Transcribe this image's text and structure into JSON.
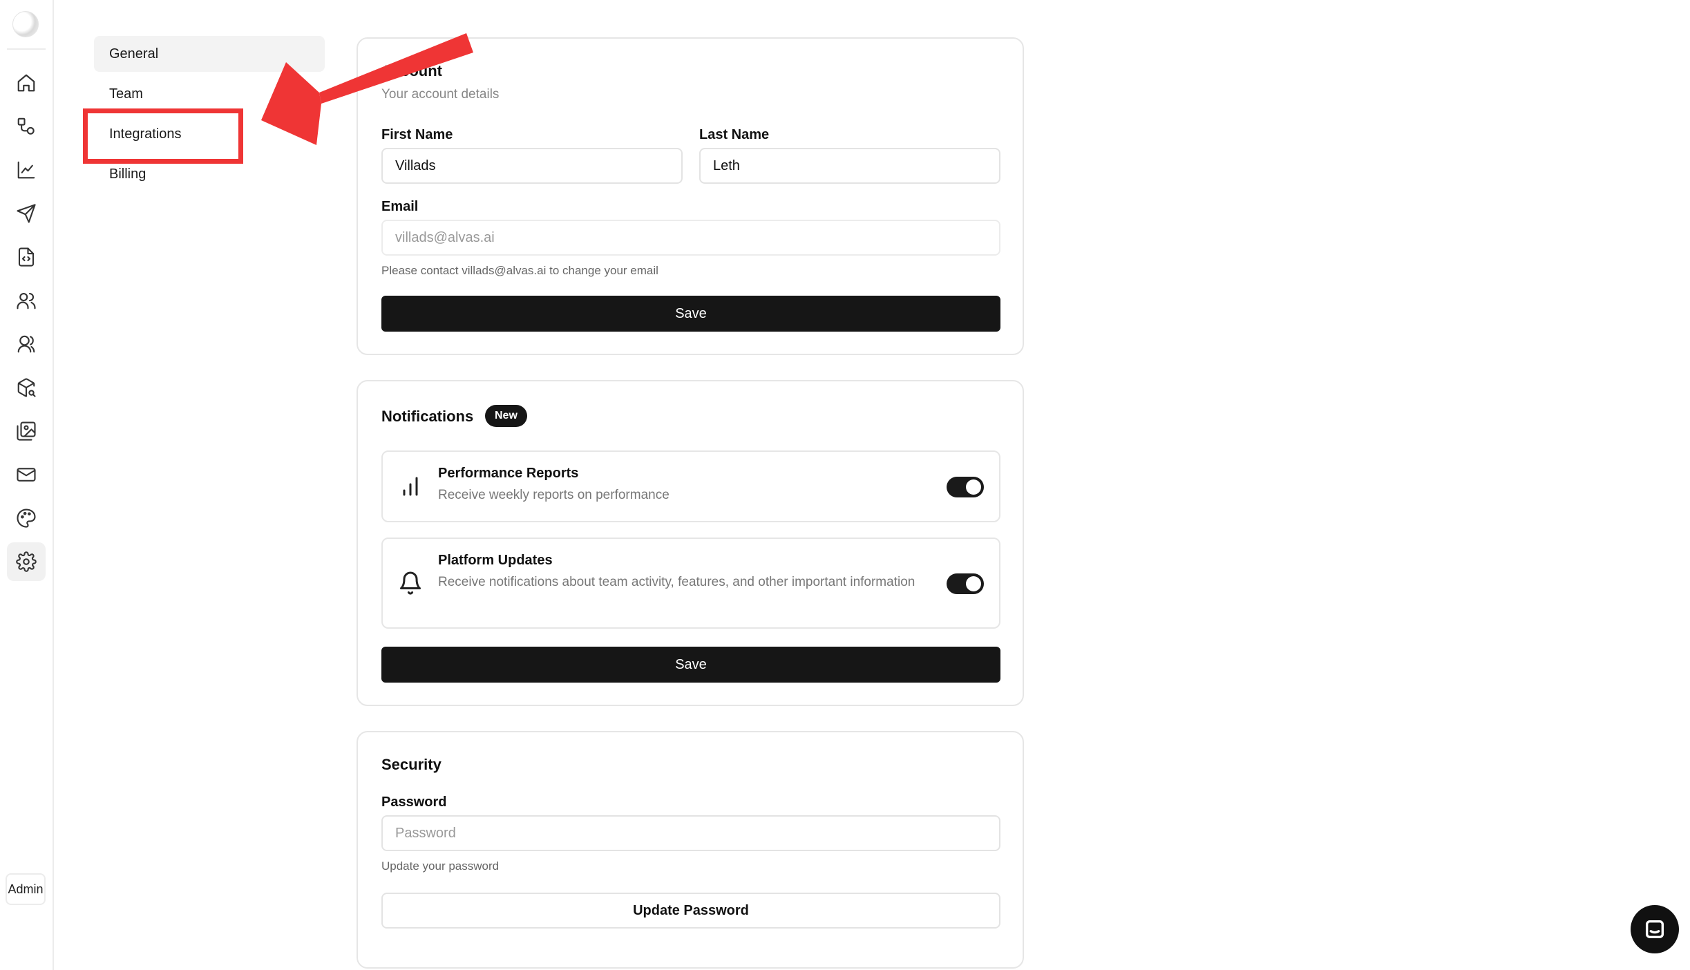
{
  "rail": {
    "items": [
      {
        "icon": "home-icon"
      },
      {
        "icon": "shapes-icon"
      },
      {
        "icon": "line-chart-icon"
      },
      {
        "icon": "send-icon"
      },
      {
        "icon": "file-code-icon"
      },
      {
        "icon": "users-icon"
      },
      {
        "icon": "contacts-icon"
      },
      {
        "icon": "package-search-icon"
      },
      {
        "icon": "image-gallery-icon"
      },
      {
        "icon": "mail-icon"
      },
      {
        "icon": "palette-icon"
      },
      {
        "icon": "gear-icon",
        "active": true
      }
    ],
    "admin_label": "Admin"
  },
  "subnav": {
    "items": [
      {
        "label": "General",
        "selected": true
      },
      {
        "label": "Team"
      },
      {
        "label": "Integrations"
      },
      {
        "label": "Billing"
      }
    ]
  },
  "account": {
    "title": "Account",
    "subtitle": "Your account details",
    "first_name_label": "First Name",
    "first_name_value": "Villads",
    "last_name_label": "Last Name",
    "last_name_value": "Leth",
    "email_label": "Email",
    "email_value": "villads@alvas.ai",
    "email_hint": "Please contact villads@alvas.ai to change your email",
    "save_label": "Save"
  },
  "notifications": {
    "title": "Notifications",
    "badge": "New",
    "items": [
      {
        "icon": "bar-chart-icon",
        "title": "Performance Reports",
        "description": "Receive weekly reports on performance",
        "enabled": true
      },
      {
        "icon": "bell-icon",
        "title": "Platform Updates",
        "description": "Receive notifications about team activity, features, and other important information",
        "enabled": true
      }
    ],
    "save_label": "Save"
  },
  "security": {
    "title": "Security",
    "password_label": "Password",
    "password_placeholder": "Password",
    "password_hint": "Update your password",
    "update_label": "Update Password"
  },
  "annotation": {
    "color": "#ef3535"
  },
  "colors": {
    "primary": "#161616",
    "border": "#e6e6e6",
    "muted_text": "#888888"
  }
}
